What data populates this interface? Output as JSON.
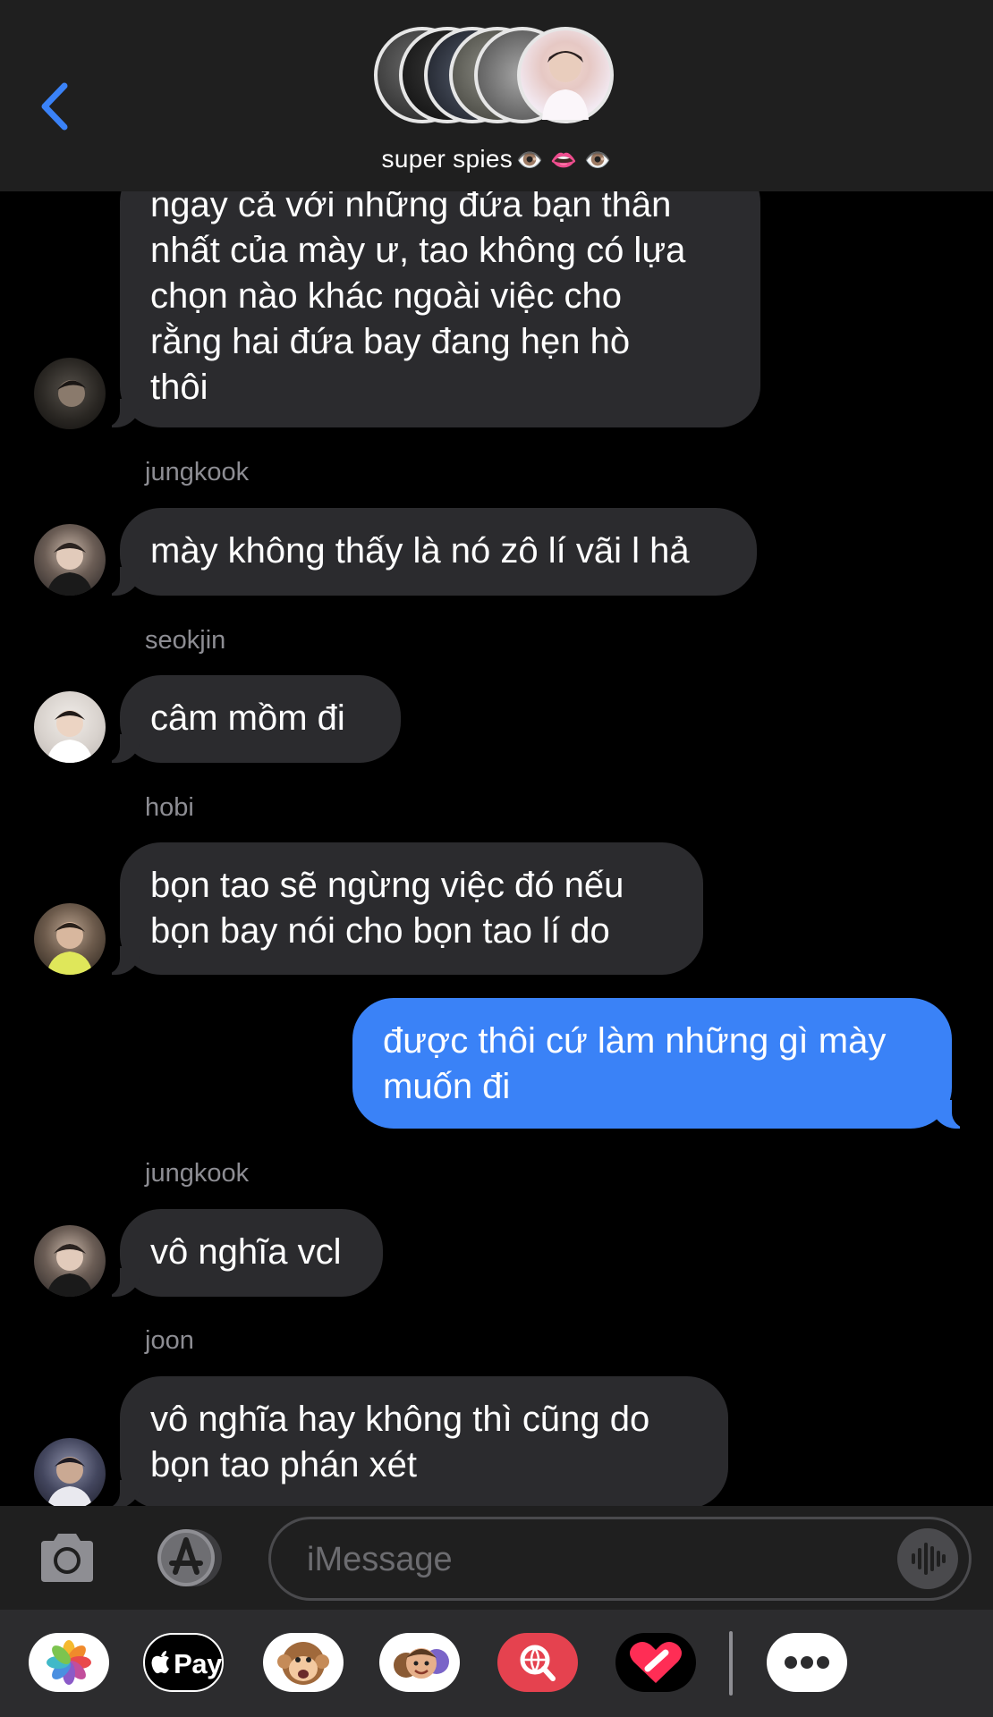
{
  "header": {
    "back_icon": "chevron-left-icon",
    "group_name": "super spies",
    "group_emoji": "👁️ 👄 👁️"
  },
  "messages": [
    {
      "direction": "incoming",
      "sender": "",
      "lines": [
        "ngay cả với những đứa bạn thân",
        "nhất của mày ư, tao không có lựa",
        "chọn nào khác ngoài việc cho",
        "rằng hai đứa bay đang hẹn hò",
        "thôi"
      ]
    },
    {
      "direction": "incoming",
      "sender": "jungkook",
      "lines": [
        "mày không thấy là nó zô lí vãi l hả"
      ]
    },
    {
      "direction": "incoming",
      "sender": "seokjin",
      "lines": [
        "câm mồm đi"
      ]
    },
    {
      "direction": "incoming",
      "sender": "hobi",
      "lines": [
        "bọn tao sẽ ngừng việc đó nếu",
        "bọn bay nói cho bọn tao lí do"
      ]
    },
    {
      "direction": "outgoing",
      "sender": "",
      "lines": [
        "được thôi cứ làm những gì mày",
        "muốn đi"
      ]
    },
    {
      "direction": "incoming",
      "sender": "jungkook",
      "lines": [
        "vô nghĩa vcl"
      ]
    },
    {
      "direction": "incoming",
      "sender": "joon",
      "lines": [
        "vô nghĩa hay không thì cũng do",
        "bọn tao phán xét"
      ]
    }
  ],
  "input_bar": {
    "camera_icon": "camera-icon",
    "apps_icon": "app-store-icon",
    "placeholder": "iMessage",
    "audio_icon": "audio-waveform-icon"
  },
  "app_drawer": {
    "apps": [
      "photos-icon",
      "apple-pay-icon",
      "animoji-icon",
      "memoji-icon",
      "image-search-icon",
      "digital-touch-icon",
      "more-icon"
    ],
    "apple_pay_label": "Pay"
  },
  "colors": {
    "background": "#000000",
    "header": "#1f1f1f",
    "incoming_bubble": "#2b2b2e",
    "outgoing_bubble": "#3a82f7",
    "sender_label": "#8d8d93",
    "accent": "#3a82f7"
  }
}
